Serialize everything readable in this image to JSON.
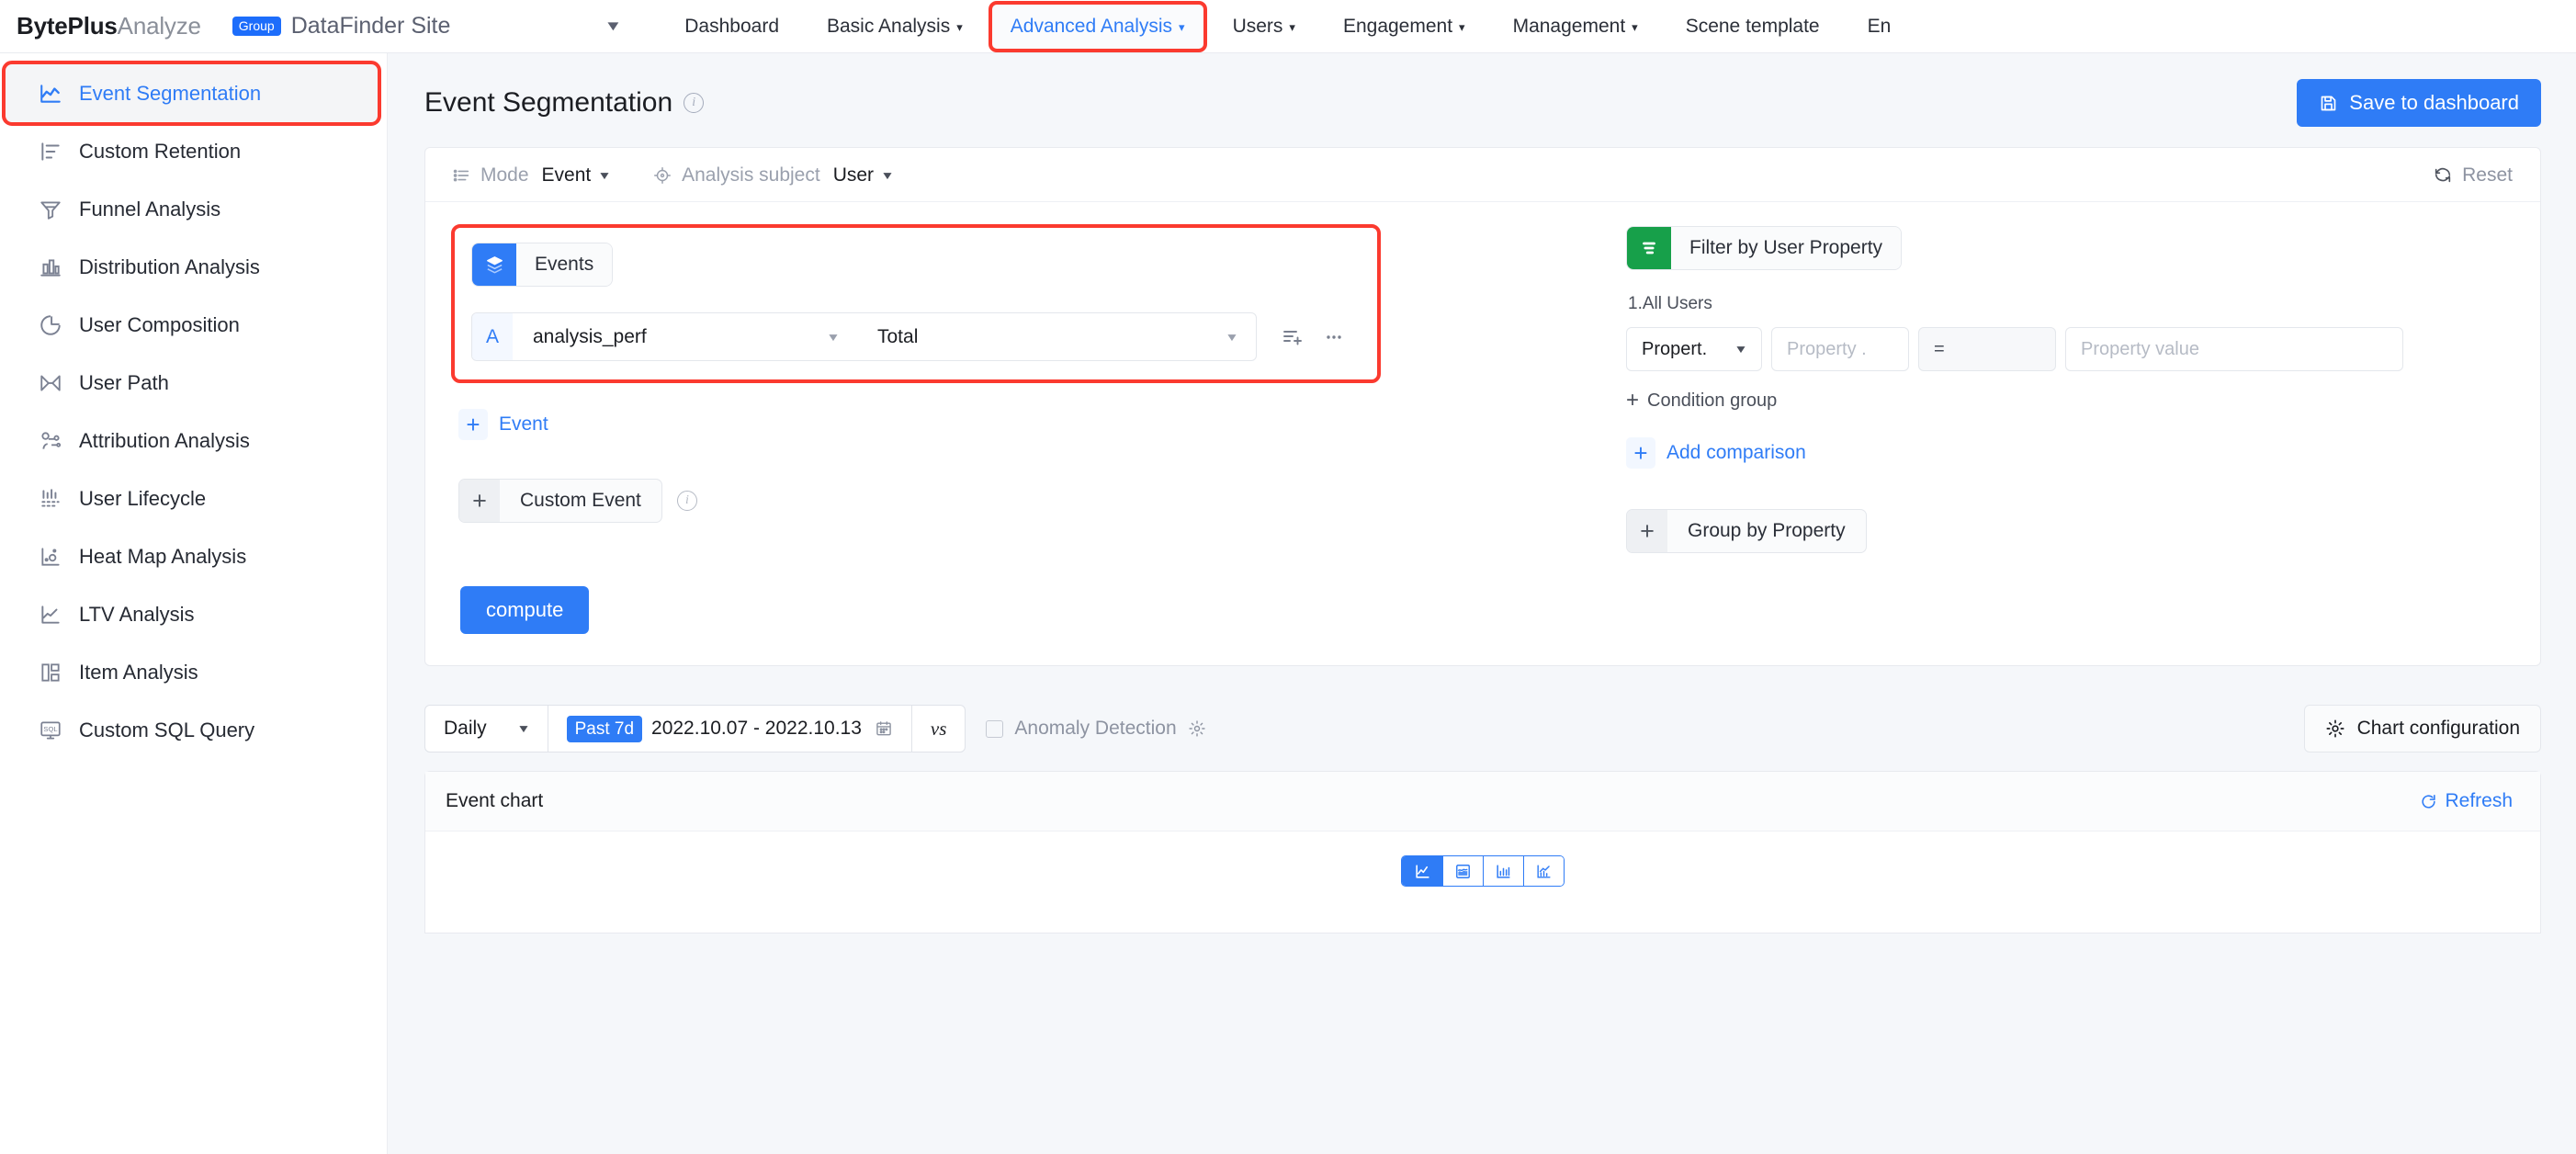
{
  "brand": {
    "bold": "BytePlus",
    "light": "Analyze"
  },
  "topnav": {
    "group_badge": "Group",
    "site_name": "DataFinder Site",
    "items": [
      {
        "label": "Dashboard",
        "caret": "",
        "state": "normal"
      },
      {
        "label": "Basic Analysis",
        "caret": "⌄",
        "state": "normal"
      },
      {
        "label": "Advanced Analysis",
        "caret": "⌄",
        "state": "highlighted-active"
      },
      {
        "label": "Users",
        "caret": "⌄",
        "state": "normal"
      },
      {
        "label": "Engagement",
        "caret": "⌄",
        "state": "normal"
      },
      {
        "label": "Management",
        "caret": "⌄",
        "state": "normal"
      },
      {
        "label": "Scene template",
        "caret": "",
        "state": "normal"
      },
      {
        "label": "En",
        "caret": "",
        "state": "cut-off"
      }
    ],
    "accent_color": "#2f7cf6",
    "highlight_color": "#fb3a2f"
  },
  "sidebar": {
    "items": [
      {
        "label": "Event Segmentation",
        "icon": "line-chart-icon",
        "active": true,
        "highlighted": true
      },
      {
        "label": "Custom Retention",
        "icon": "retention-bars-icon",
        "active": false,
        "highlighted": false
      },
      {
        "label": "Funnel Analysis",
        "icon": "funnel-icon",
        "active": false,
        "highlighted": false
      },
      {
        "label": "Distribution Analysis",
        "icon": "bar-chart-icon",
        "active": false,
        "highlighted": false
      },
      {
        "label": "User Composition",
        "icon": "pie-chart-icon",
        "active": false,
        "highlighted": false
      },
      {
        "label": "User Path",
        "icon": "path-icon",
        "active": false,
        "highlighted": false
      },
      {
        "label": "Attribution Analysis",
        "icon": "attribution-nodes-icon",
        "active": false,
        "highlighted": false
      },
      {
        "label": "User Lifecycle",
        "icon": "lifecycle-icon",
        "active": false,
        "highlighted": false
      },
      {
        "label": "Heat Map Analysis",
        "icon": "heatmap-icon",
        "active": false,
        "highlighted": false
      },
      {
        "label": "LTV Analysis",
        "icon": "ltv-line-icon",
        "active": false,
        "highlighted": false
      },
      {
        "label": "Item Analysis",
        "icon": "item-blocks-icon",
        "active": false,
        "highlighted": false
      },
      {
        "label": "Custom SQL Query",
        "icon": "sql-monitor-icon",
        "active": false,
        "highlighted": false
      }
    ]
  },
  "page": {
    "title": "Event Segmentation",
    "info_icon": "info-icon",
    "save_button": "Save to dashboard",
    "save_icon": "save-disk-icon"
  },
  "builder": {
    "mode_label": "Mode",
    "mode_value": "Event",
    "subject_label": "Analysis subject",
    "subject_value": "User",
    "subject_icon": "target-icon",
    "mode_icon": "list-icon",
    "reset_label": "Reset",
    "reset_icon": "refresh-icon",
    "events_chip": {
      "label": "Events",
      "icon": "layers-icon",
      "color": "#2f7cf6"
    },
    "event_rows": [
      {
        "tag": "A",
        "event": "analysis_perf",
        "metric": "Total"
      }
    ],
    "row_icons": [
      "filter-add-icon",
      "more-ellipsis-icon"
    ],
    "add_event_label": "Event",
    "custom_event_label": "Custom Event",
    "custom_event_info": "info-icon",
    "filter_chip": {
      "label": "Filter by User Property",
      "icon": "filter-list-icon",
      "color": "#17a04a"
    },
    "filter_group_label": "1.All Users",
    "filter_fields": {
      "property_select": "Propert.",
      "property_placeholder": "Property .",
      "operator": "=",
      "value_placeholder": "Property value"
    },
    "condition_group_label": "Condition group",
    "add_comparison_label": "Add comparison",
    "group_by_label": "Group by Property",
    "compute_label": "compute"
  },
  "toolbar2": {
    "granularity": "Daily",
    "range_pill": "Past 7d",
    "date_range": "2022.10.07 - 2022.10.13",
    "calendar_icon": "calendar-icon",
    "vs_label": "vs",
    "anomaly_label": "Anomaly Detection",
    "anomaly_gear": "gear-icon",
    "chart_config_label": "Chart configuration",
    "chart_config_icon": "gear-icon"
  },
  "chart_panel": {
    "title": "Event chart",
    "refresh_label": "Refresh",
    "refresh_icon": "refresh-icon",
    "chart_types": [
      {
        "name": "line-chart-icon",
        "active": true
      },
      {
        "name": "area-chart-icon",
        "active": false
      },
      {
        "name": "bar-chart-icon",
        "active": false
      },
      {
        "name": "combo-chart-icon",
        "active": false
      }
    ]
  }
}
